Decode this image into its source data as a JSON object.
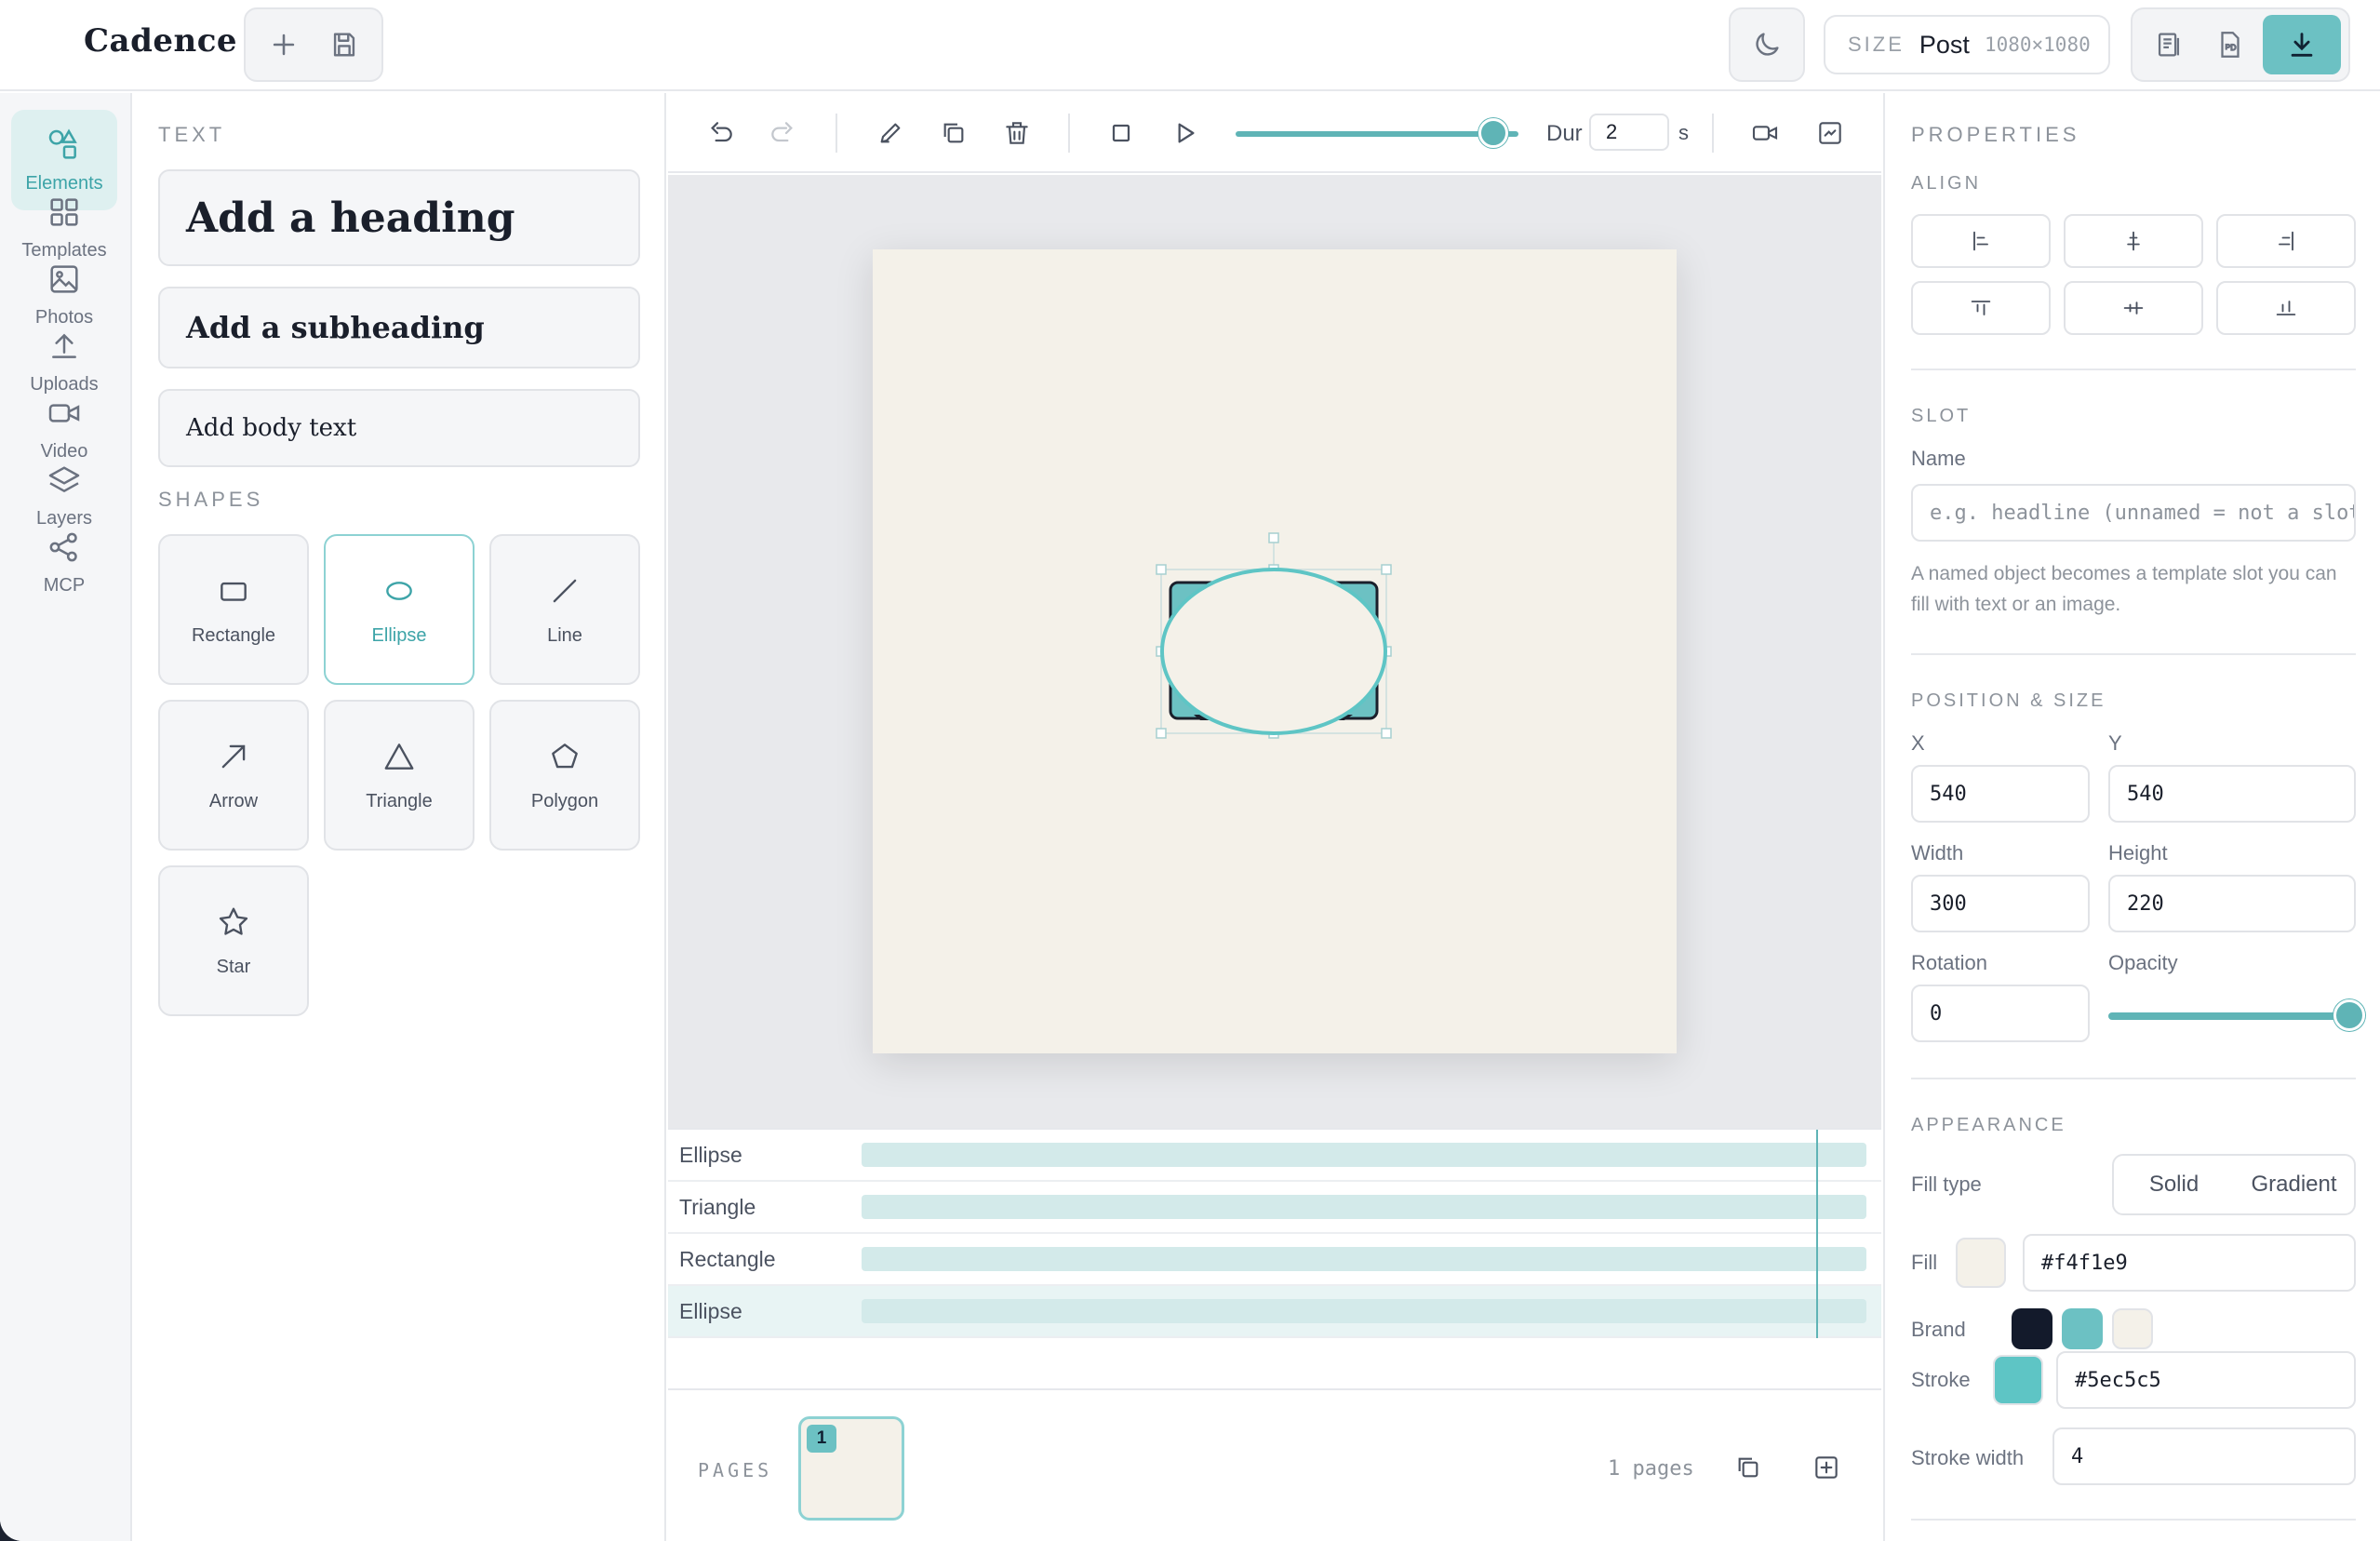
{
  "app": {
    "title": "Cadence"
  },
  "header": {
    "size_label": "SIZE",
    "size_value": "Post",
    "size_dims": "1080×1080"
  },
  "rail": {
    "items": [
      {
        "label": "Elements",
        "icon": "shapes-icon"
      },
      {
        "label": "Templates",
        "icon": "grid-icon"
      },
      {
        "label": "Photos",
        "icon": "image-icon"
      },
      {
        "label": "Uploads",
        "icon": "upload-icon"
      },
      {
        "label": "Video",
        "icon": "video-icon"
      },
      {
        "label": "Layers",
        "icon": "layers-icon"
      },
      {
        "label": "MCP",
        "icon": "share-icon"
      }
    ]
  },
  "panel": {
    "text_title": "TEXT",
    "heading": "Add a heading",
    "subheading": "Add a subheading",
    "body": "Add body text",
    "shapes_title": "SHAPES",
    "shapes": [
      "Rectangle",
      "Ellipse",
      "Line",
      "Arrow",
      "Triangle",
      "Polygon",
      "Star"
    ]
  },
  "toolbar": {
    "duration_label": "Dur",
    "duration_value": "2",
    "duration_unit": "s",
    "scrub_level": 0.91
  },
  "canvas": {
    "background": "#f4f1e9",
    "accent": "#5ec5c5"
  },
  "timeline": {
    "layers": [
      "Ellipse",
      "Triangle",
      "Rectangle",
      "Ellipse"
    ]
  },
  "pages": {
    "label": "PAGES",
    "current": "1",
    "count_text": "1 pages"
  },
  "props": {
    "title": "PROPERTIES",
    "align_title": "ALIGN",
    "slot_title": "SLOT",
    "name_label": "Name",
    "name_placeholder": "e.g. headline (unnamed = not a slot)",
    "slot_hint": "A named object becomes a template slot you can fill with text or an image.",
    "pos_title": "POSITION & SIZE",
    "x_label": "X",
    "x_value": "540",
    "y_label": "Y",
    "y_value": "540",
    "w_label": "Width",
    "w_value": "300",
    "h_label": "Height",
    "h_value": "220",
    "rot_label": "Rotation",
    "rot_value": "0",
    "opacity_label": "Opacity",
    "opacity_level": 1.0,
    "appearance_title": "APPEARANCE",
    "fill_type_label": "Fill type",
    "fill_solid": "Solid",
    "fill_gradient": "Gradient",
    "fill_label": "Fill",
    "fill_value": "#f4f1e9",
    "brand_label": "Brand",
    "brand_colors": [
      "#131a2b",
      "#6cc1c3",
      "#f4f1e9"
    ],
    "stroke_label": "Stroke",
    "stroke_value": "#5ec5c5",
    "stroke_width_label": "Stroke width",
    "stroke_width_value": "4"
  }
}
